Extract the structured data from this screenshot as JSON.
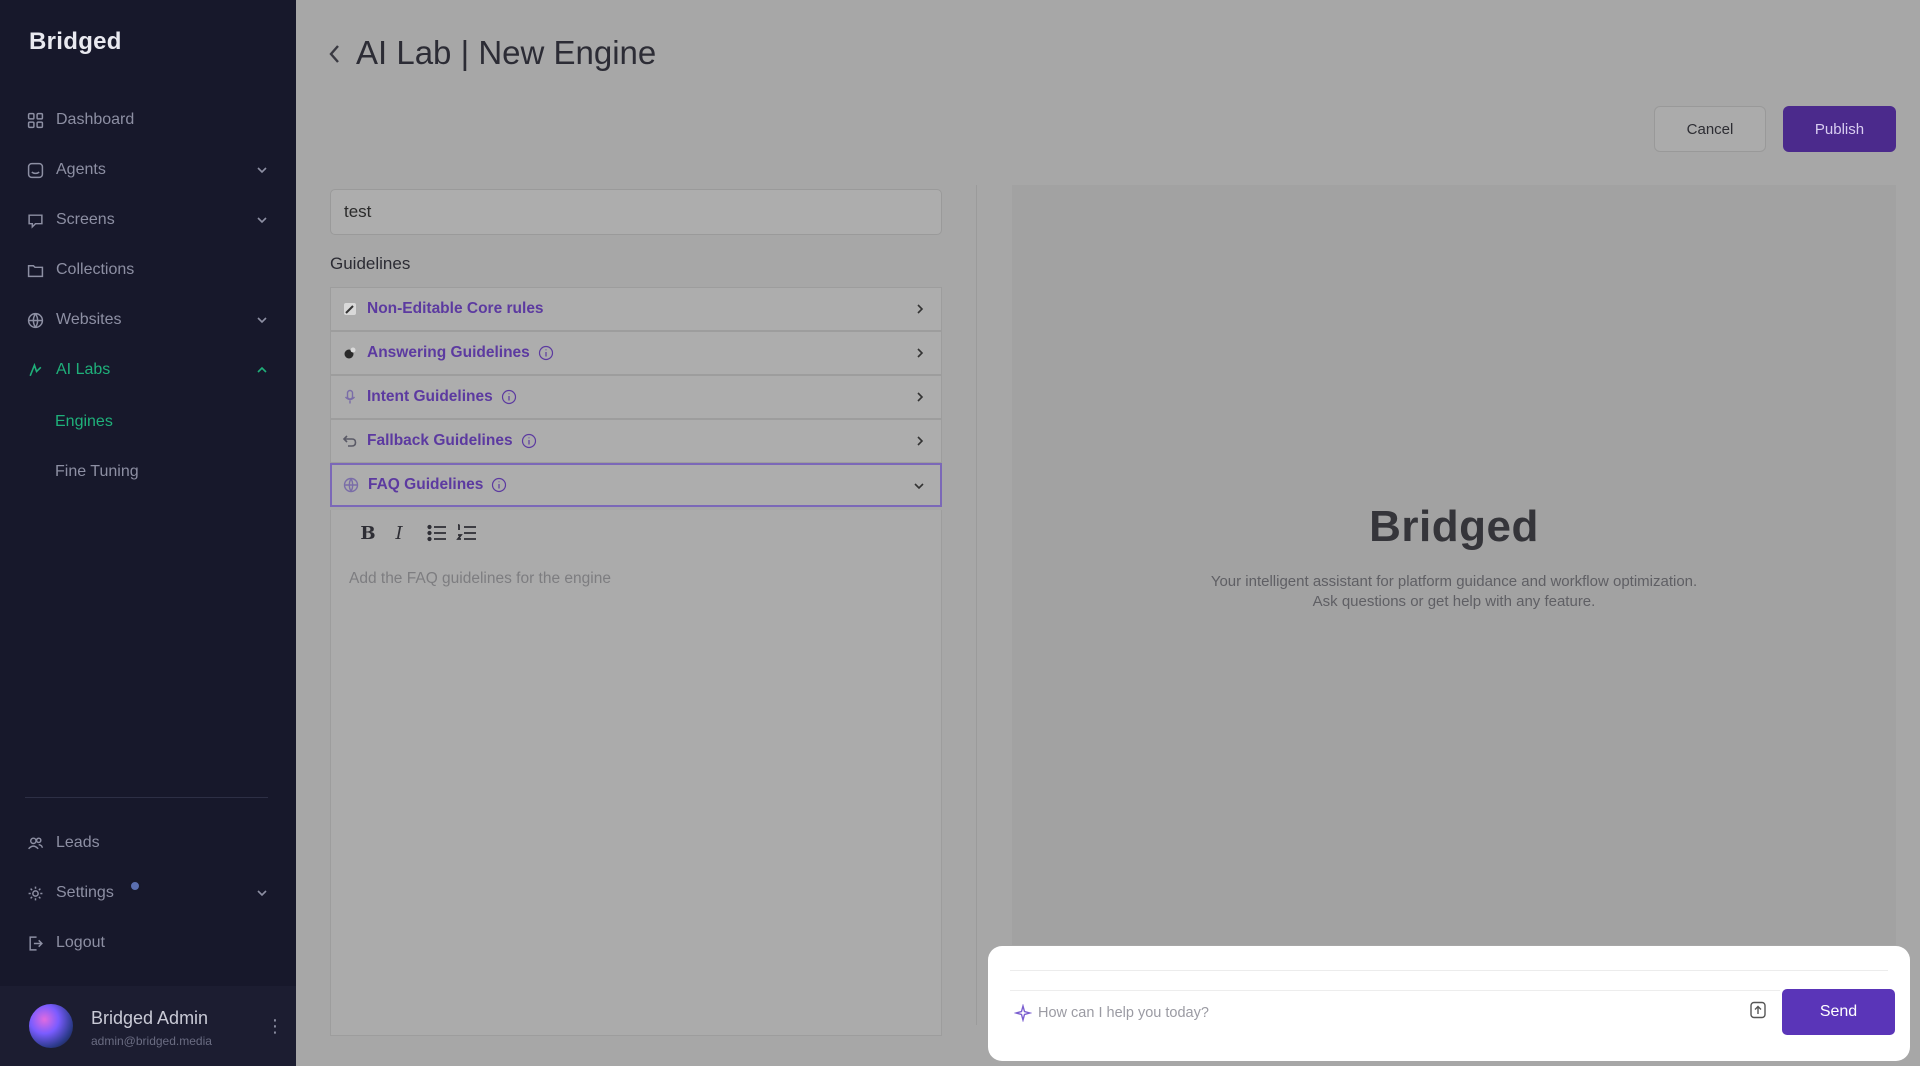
{
  "app": {
    "logo": "Bridged",
    "page_title": "AI Lab | New Engine"
  },
  "sidebar": {
    "items": [
      {
        "label": "Dashboard",
        "icon": "grid-icon"
      },
      {
        "label": "Agents",
        "icon": "agent-icon"
      },
      {
        "label": "Screens",
        "icon": "screen-icon"
      },
      {
        "label": "Collections",
        "icon": "folder-icon"
      },
      {
        "label": "Websites",
        "icon": "globe-icon"
      },
      {
        "label": "AI Labs",
        "icon": "ai-icon"
      }
    ],
    "sub_items": [
      {
        "label": "Engines"
      },
      {
        "label": "Fine Tuning"
      }
    ],
    "bottom_items": [
      {
        "label": "Leads",
        "icon": "users-icon"
      },
      {
        "label": "Settings",
        "icon": "gear-icon"
      },
      {
        "label": "Logout",
        "icon": "logout-icon"
      }
    ],
    "user": {
      "name": "Bridged Admin",
      "email": "admin@bridged.media"
    }
  },
  "header": {
    "cancel_label": "Cancel",
    "publish_label": "Publish"
  },
  "engine": {
    "name_value": "test",
    "guidelines_label": "Guidelines",
    "guidelines": [
      {
        "label": "Non-Editable Core rules"
      },
      {
        "label": "Answering Guidelines"
      },
      {
        "label": "Intent Guidelines"
      },
      {
        "label": "Fallback Guidelines"
      },
      {
        "label": "FAQ Guidelines"
      }
    ],
    "editor_placeholder": "Add the FAQ guidelines for the engine"
  },
  "preview": {
    "logo": "Bridged",
    "subtitle_line1": "Your intelligent assistant for platform guidance and workflow optimization.",
    "subtitle_line2": "Ask questions or get help with any feature.",
    "chat_placeholder": "How can I help you today?",
    "send_label": "Send"
  },
  "colors": {
    "sidebar_bg": "#17182b",
    "accent_green": "#1fb07a",
    "accent_purple": "#5a35b8",
    "overlay_gray": "#a7a7a7"
  }
}
